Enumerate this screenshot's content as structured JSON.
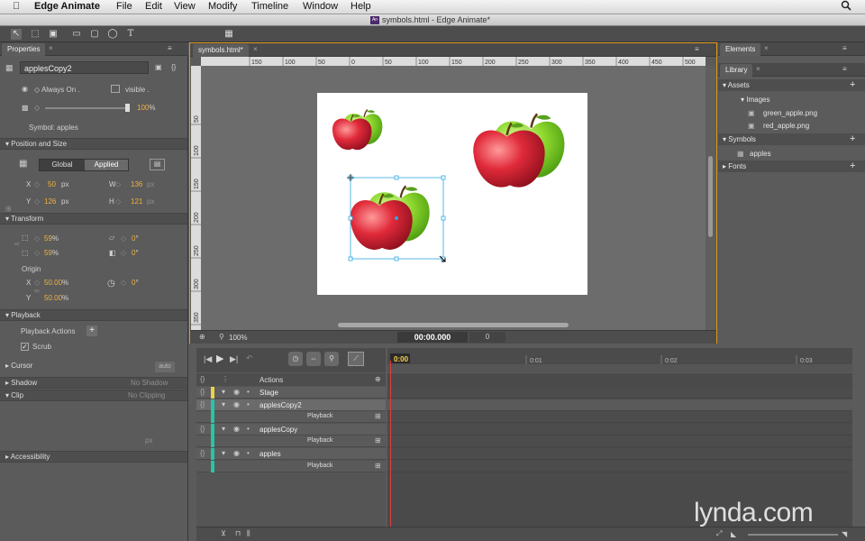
{
  "menubar": {
    "app_name": "Edge Animate",
    "items": [
      "File",
      "Edit",
      "View",
      "Modify",
      "Timeline",
      "Window",
      "Help"
    ]
  },
  "window": {
    "title": "symbols.html - Edge Animate*"
  },
  "properties": {
    "tab": "Properties",
    "element_name": "applesCopy2",
    "display": "Always On",
    "visibility": "visible",
    "opacity": "100",
    "opacity_unit": "%",
    "symbol_label": "Symbol: apples",
    "position_section": "Position and Size",
    "global_btn": "Global",
    "applied_btn": "Applied",
    "x_label": "X",
    "x_value": "50",
    "x_unit": "px",
    "y_label": "Y",
    "y_value": "126",
    "y_unit": "px",
    "w_label": "W",
    "w_value": "136",
    "w_unit": "px",
    "h_label": "H",
    "h_value": "121",
    "h_unit": "px",
    "transform_section": "Transform",
    "scale_x": "59",
    "scale_y": "59",
    "scale_unit": "%",
    "skew_x": "0",
    "skew_y": "0",
    "deg": "°",
    "origin_label": "Origin",
    "origin_x_label": "X",
    "origin_x": "50.00",
    "origin_y_label": "Y",
    "origin_y": "50.00",
    "origin_unit": "%",
    "rotate": "0",
    "playback_section": "Playback",
    "playback_actions": "Playback Actions",
    "scrub": "Scrub",
    "cursor_section": "Cursor",
    "cursor_value": "auto",
    "shadow_section": "Shadow",
    "shadow_value": "No Shadow",
    "clip_section": "Clip",
    "clip_value": "No Clipping",
    "clip_unit": "px",
    "accessibility_section": "Accessibility"
  },
  "document": {
    "tab": "symbols.html*",
    "ruler_h": [
      "150",
      "100",
      "50",
      "0",
      "50",
      "100",
      "150",
      "200",
      "250",
      "300",
      "350",
      "400",
      "450",
      "500",
      "550"
    ],
    "ruler_v": [
      "50",
      "100",
      "150",
      "200",
      "250",
      "300",
      "350"
    ],
    "zoom": "100",
    "zoom_unit": "%",
    "time": "00:00.000",
    "frame": "0"
  },
  "elements_panel": {
    "tab": "Elements"
  },
  "library": {
    "tab": "Library",
    "assets": "Assets",
    "images": "Images",
    "image_items": [
      "green_apple.png",
      "red_apple.png"
    ],
    "symbols": "Symbols",
    "symbol_items": [
      "apples"
    ],
    "fonts": "Fonts"
  },
  "timeline": {
    "time_markers": [
      "0:00",
      "0:01",
      "0:02",
      "0:03"
    ],
    "actions_label": "Actions",
    "rows": [
      {
        "name": "Stage",
        "color": "#e8d24a"
      },
      {
        "name": "applesCopy2",
        "color": "#27c4a8"
      },
      {
        "name": "Playback",
        "sub": true
      },
      {
        "name": "applesCopy",
        "color": "#27c4a8"
      },
      {
        "name": "Playback",
        "sub": true
      },
      {
        "name": "apples",
        "color": "#27c4a8"
      },
      {
        "name": "Playback",
        "sub": true
      }
    ]
  },
  "watermark": "lynda.com",
  "colors": {
    "accent": "#f0a500",
    "selection": "#2aa8e0",
    "playhead": "#e04040",
    "layer": "#27c4a8"
  }
}
